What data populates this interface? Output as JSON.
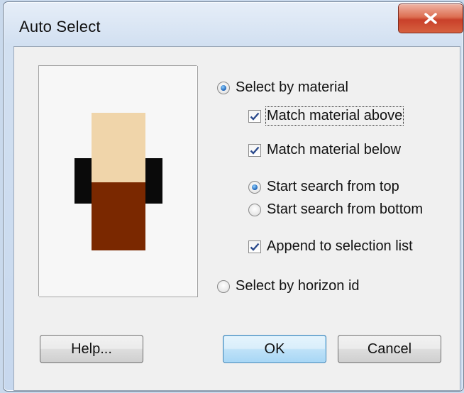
{
  "window": {
    "title": "Auto Select"
  },
  "preview": {
    "top_material_color": "#f0d5aa",
    "bottom_material_color": "#7a2800",
    "horizon_marker_color": "#0a0a0a"
  },
  "options": {
    "select_by_material": {
      "label": "Select by material",
      "selected": true
    },
    "match_material_above": {
      "label": "Match material above",
      "checked": true
    },
    "match_material_below": {
      "label": "Match material below",
      "checked": true
    },
    "start_search_from_top": {
      "label": "Start search from top",
      "selected": true
    },
    "start_search_from_bottom": {
      "label": "Start search from bottom",
      "selected": false
    },
    "append_to_selection_list": {
      "label": "Append to selection list",
      "checked": true
    },
    "select_by_horizon_id": {
      "label": "Select by horizon id",
      "selected": false
    }
  },
  "buttons": {
    "help": "Help...",
    "ok": "OK",
    "cancel": "Cancel"
  },
  "colors": {
    "close_button": "#c9402a",
    "check_mark": "#2b4a8c",
    "default_button_border": "#3c7fb1"
  }
}
